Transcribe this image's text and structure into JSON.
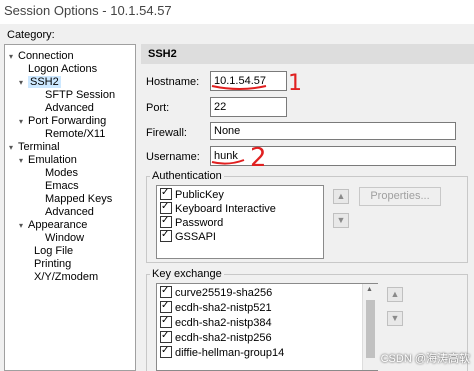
{
  "window": {
    "title": "Session Options - 10.1.54.57"
  },
  "category_label": "Category:",
  "tree": {
    "connection": "Connection",
    "logon_actions": "Logon Actions",
    "ssh2": "SSH2",
    "sftp_session": "SFTP Session",
    "advanced": "Advanced",
    "port_forwarding": "Port Forwarding",
    "remote_x11": "Remote/X11",
    "terminal": "Terminal",
    "emulation": "Emulation",
    "modes": "Modes",
    "emacs": "Emacs",
    "mapped_keys": "Mapped Keys",
    "advanced2": "Advanced",
    "appearance": "Appearance",
    "window": "Window",
    "log_file": "Log File",
    "printing": "Printing",
    "xyzmodem": "X/Y/Zmodem"
  },
  "panel": {
    "title": "SSH2"
  },
  "fields": {
    "hostname_label": "Hostname:",
    "hostname_value": "10.1.54.57",
    "port_label": "Port:",
    "port_value": "22",
    "firewall_label": "Firewall:",
    "firewall_value": "None",
    "username_label": "Username:",
    "username_value": "hunk"
  },
  "authentication": {
    "label": "Authentication",
    "items": [
      "PublicKey",
      "Keyboard Interactive",
      "Password",
      "GSSAPI"
    ],
    "properties_button": "Properties..."
  },
  "key_exchange": {
    "label": "Key exchange",
    "items": [
      "curve25519-sha256",
      "ecdh-sha2-nistp521",
      "ecdh-sha2-nistp384",
      "ecdh-sha2-nistp256",
      "diffie-hellman-group14"
    ]
  },
  "annotations": {
    "mark_1": "1",
    "mark_2": "2"
  },
  "watermark": "CSDN @海涛高软",
  "colors": {
    "annotation_red": "#e02020",
    "selection": "#cde8ff"
  }
}
